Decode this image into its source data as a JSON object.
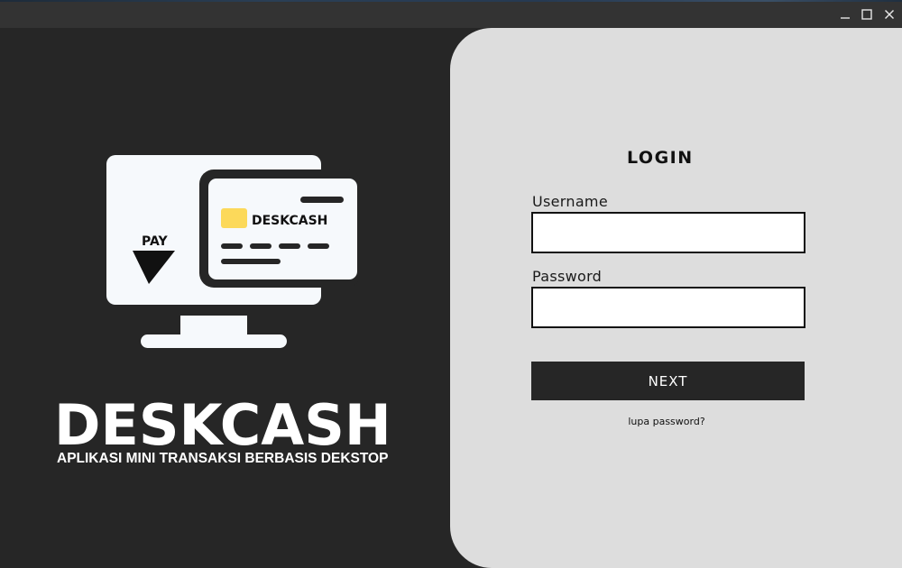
{
  "window": {
    "controls": {
      "minimize_icon": "minimize-icon",
      "maximize_icon": "maximize-icon",
      "close_icon": "close-icon"
    }
  },
  "branding": {
    "logo": {
      "pay_label": "PAY",
      "card_label": "DESKCASH"
    },
    "title": "DESKCASH",
    "subtitle": "APLIKASI MINI TRANSAKSI BERBASIS DEKSTOP"
  },
  "login": {
    "title": "LOGIN",
    "username_label": "Username",
    "username_value": "",
    "password_label": "Password",
    "password_value": "",
    "next_label": "NEXT",
    "forgot_label": "lupa password?"
  },
  "colors": {
    "background": "#262626",
    "card": "#dddddd",
    "accent_yellow": "#fcd95a",
    "text_light": "#ffffff",
    "text_dark": "#111111"
  }
}
